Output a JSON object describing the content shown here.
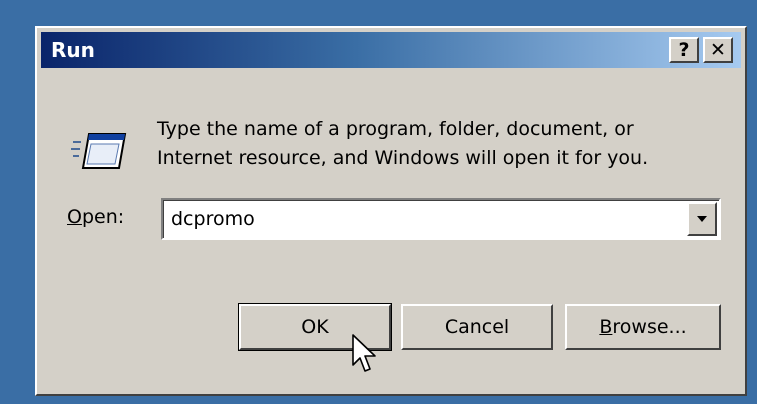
{
  "window": {
    "title": "Run",
    "help_label": "?",
    "close_label": "✕"
  },
  "description": {
    "line1": "Type the name of a program, folder, document, or",
    "line2": "Internet resource, and Windows will open it for you."
  },
  "open_field": {
    "label_mnemonic": "O",
    "label_rest": "pen:",
    "value": "dcpromo"
  },
  "buttons": {
    "ok": "OK",
    "cancel": "Cancel",
    "browse_mnemonic": "B",
    "browse_rest": "rowse..."
  },
  "icons": [
    "run-icon",
    "help-icon",
    "close-icon",
    "dropdown-arrow-icon",
    "mouse-cursor-icon"
  ],
  "colors": {
    "desktop": "#3a6ea5",
    "dialog_face": "#d4d0c8",
    "titlebar_start": "#0a246a",
    "titlebar_end": "#a6caf0"
  }
}
